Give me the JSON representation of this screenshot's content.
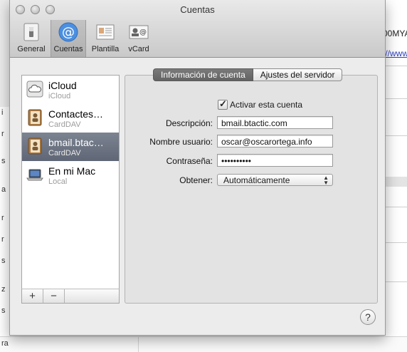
{
  "window": {
    "title": "Cuentas"
  },
  "toolbar": {
    "items": [
      {
        "label": "General",
        "icon": "switch-icon"
      },
      {
        "label": "Cuentas",
        "icon": "at-icon"
      },
      {
        "label": "Plantilla",
        "icon": "template-icon"
      },
      {
        "label": "vCard",
        "icon": "vcard-icon"
      }
    ],
    "selected": "Cuentas"
  },
  "accounts": [
    {
      "name": "iCloud",
      "type": "iCloud",
      "icon": "cloud-icon"
    },
    {
      "name": "Contactes…",
      "type": "CardDAV",
      "icon": "address-book-icon"
    },
    {
      "name": "bmail.btac…",
      "type": "CardDAV",
      "icon": "address-book-icon"
    },
    {
      "name": "En mi Mac",
      "type": "Local",
      "icon": "laptop-icon"
    }
  ],
  "selected_account": "bmail.btac…",
  "list_footer": {
    "add": "+",
    "remove": "−"
  },
  "tabs": [
    {
      "label": "Información de cuenta",
      "active": true
    },
    {
      "label": "Ajustes del servidor",
      "active": false
    }
  ],
  "form": {
    "enable_label": "Activar esta cuenta",
    "enable_checked": true,
    "description_label": "Descripción:",
    "description_value": "bmail.btactic.com",
    "username_label": "Nombre usuario:",
    "username_value": "oscar@oscarortega.info",
    "password_label": "Contraseña:",
    "password_value": "••••••••••",
    "fetch_label": "Obtener:",
    "fetch_value": "Automáticamente"
  },
  "help": {
    "label": "?"
  },
  "background": {
    "text1": "00MYA",
    "text2": "://www",
    "left_letters": [
      "i",
      "r",
      "s",
      "a",
      "r",
      "r",
      "s",
      "z",
      "s",
      "ra"
    ]
  }
}
